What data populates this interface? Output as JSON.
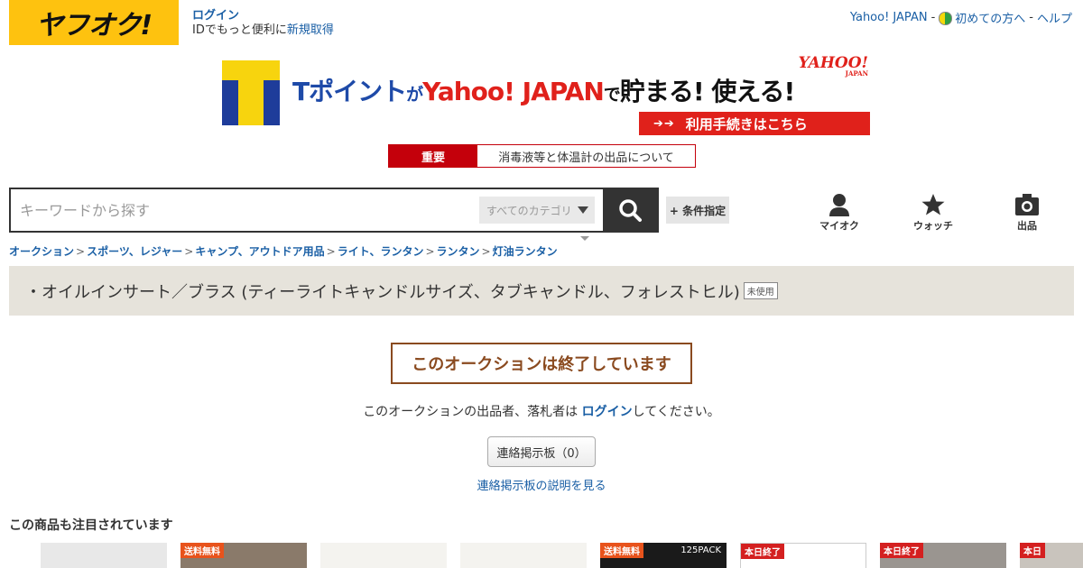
{
  "header": {
    "logo_text": "ヤフオク!",
    "login_label": "ログイン",
    "login_note_prefix": "IDでもっと便利に",
    "register_label": "新規取得",
    "top_links": {
      "yahoo": "Yahoo! JAPAN",
      "sep1": "-",
      "beginner": "初めての方へ",
      "sep2": "-",
      "help": "ヘルプ"
    }
  },
  "banner": {
    "t_point": "Tポイント",
    "ga": "が",
    "yahoo_japan": "Yahoo! JAPAN",
    "de": "で",
    "tamaru": "貯まる! 使える!",
    "yahoo_mark": "YAHOO!",
    "yahoo_mark_sub": "JAPAN",
    "cta_arrows": "➔➔",
    "cta_label": "利用手続きはこちら"
  },
  "notice": {
    "tag": "重要",
    "text": "消毒液等と体温計の出品について"
  },
  "search": {
    "placeholder": "キーワードから探す",
    "category": "すべてのカテゴリ",
    "condition_label": "+ 条件指定"
  },
  "nav": {
    "myauction": "マイオク",
    "watch": "ウォッチ",
    "sell": "出品"
  },
  "breadcrumb": [
    "オークション",
    "スポーツ、レジャー",
    "キャンプ、アウトドア用品",
    "ライト、ランタン",
    "ランタン",
    "灯油ランタン"
  ],
  "breadcrumb_sep": ">",
  "item": {
    "title": "・オイルインサート／ブラス (ティーライトキャンドルサイズ、タブキャンドル、フォレストヒル)",
    "condition": "未使用"
  },
  "ended": {
    "message": "このオークションは終了しています",
    "note_prefix": "このオークションの出品者、落札者は ",
    "note_link": "ログイン",
    "note_suffix": "してください。",
    "board_button": "連絡掲示板（0）",
    "board_help": "連絡掲示板の説明を見る"
  },
  "recommend": {
    "title": "この商品も注目されています",
    "items": [
      {
        "label": ""
      },
      {
        "label": "送料無料"
      },
      {
        "label": ""
      },
      {
        "label": ""
      },
      {
        "label": "送料無料",
        "extra": "125PACK"
      },
      {
        "label": "本日終了"
      },
      {
        "label": "本日終了"
      },
      {
        "label": "本日"
      }
    ]
  }
}
